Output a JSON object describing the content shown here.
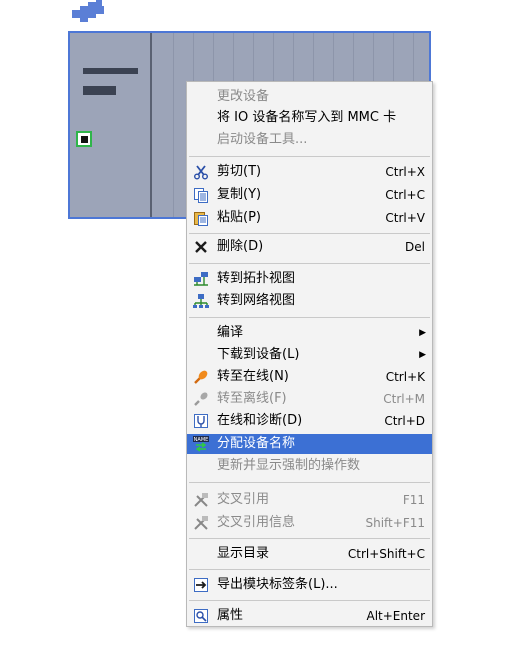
{
  "colors": {
    "highlight": "#3c70d4",
    "disabled_text": "#8a8a8a",
    "module_fill": "#9ca4b8",
    "module_border": "#4d77d6",
    "port_border": "#2fb54a"
  },
  "menu": {
    "items": [
      {
        "label": "更改设备",
        "shortcut": "",
        "icon": "",
        "disabled": true
      },
      {
        "label": "将 IO 设备名称写入到 MMC 卡",
        "shortcut": "",
        "icon": "",
        "disabled": false
      },
      {
        "label": "启动设备工具...",
        "shortcut": "",
        "icon": "",
        "disabled": true
      },
      {
        "label": "剪切(T)",
        "shortcut": "Ctrl+X",
        "icon": "scissors-icon",
        "disabled": false
      },
      {
        "label": "复制(Y)",
        "shortcut": "Ctrl+C",
        "icon": "copy-icon",
        "disabled": false
      },
      {
        "label": "粘贴(P)",
        "shortcut": "Ctrl+V",
        "icon": "paste-icon",
        "disabled": false
      },
      {
        "label": "删除(D)",
        "shortcut": "Del",
        "icon": "delete-x-icon",
        "disabled": false
      },
      {
        "label": "转到拓扑视图",
        "shortcut": "",
        "icon": "topology-view-icon",
        "disabled": false
      },
      {
        "label": "转到网络视图",
        "shortcut": "",
        "icon": "network-view-icon",
        "disabled": false
      },
      {
        "label": "编译",
        "shortcut": "",
        "icon": "",
        "disabled": false,
        "submenu": true
      },
      {
        "label": "下载到设备(L)",
        "shortcut": "",
        "icon": "",
        "disabled": false,
        "submenu": true
      },
      {
        "label": "转至在线(N)",
        "shortcut": "Ctrl+K",
        "icon": "go-online-icon",
        "disabled": false
      },
      {
        "label": "转至离线(F)",
        "shortcut": "Ctrl+M",
        "icon": "go-offline-icon",
        "disabled": true
      },
      {
        "label": "在线和诊断(D)",
        "shortcut": "Ctrl+D",
        "icon": "diagnostics-icon",
        "disabled": false
      },
      {
        "label": "分配设备名称",
        "shortcut": "",
        "icon": "assign-name-icon",
        "disabled": false,
        "highlighted": true
      },
      {
        "label": "更新并显示强制的操作数",
        "shortcut": "",
        "icon": "",
        "disabled": true
      },
      {
        "label": "交叉引用",
        "shortcut": "F11",
        "icon": "cross-reference-icon",
        "disabled": true
      },
      {
        "label": "交叉引用信息",
        "shortcut": "Shift+F11",
        "icon": "cross-reference-info-icon",
        "disabled": true
      },
      {
        "label": "显示目录",
        "shortcut": "Ctrl+Shift+C",
        "icon": "",
        "disabled": false
      },
      {
        "label": "导出模块标签条(L)...",
        "shortcut": "",
        "icon": "export-arrow-icon",
        "disabled": false
      },
      {
        "label": "属性",
        "shortcut": "Alt+Enter",
        "icon": "properties-icon",
        "disabled": false
      }
    ]
  }
}
